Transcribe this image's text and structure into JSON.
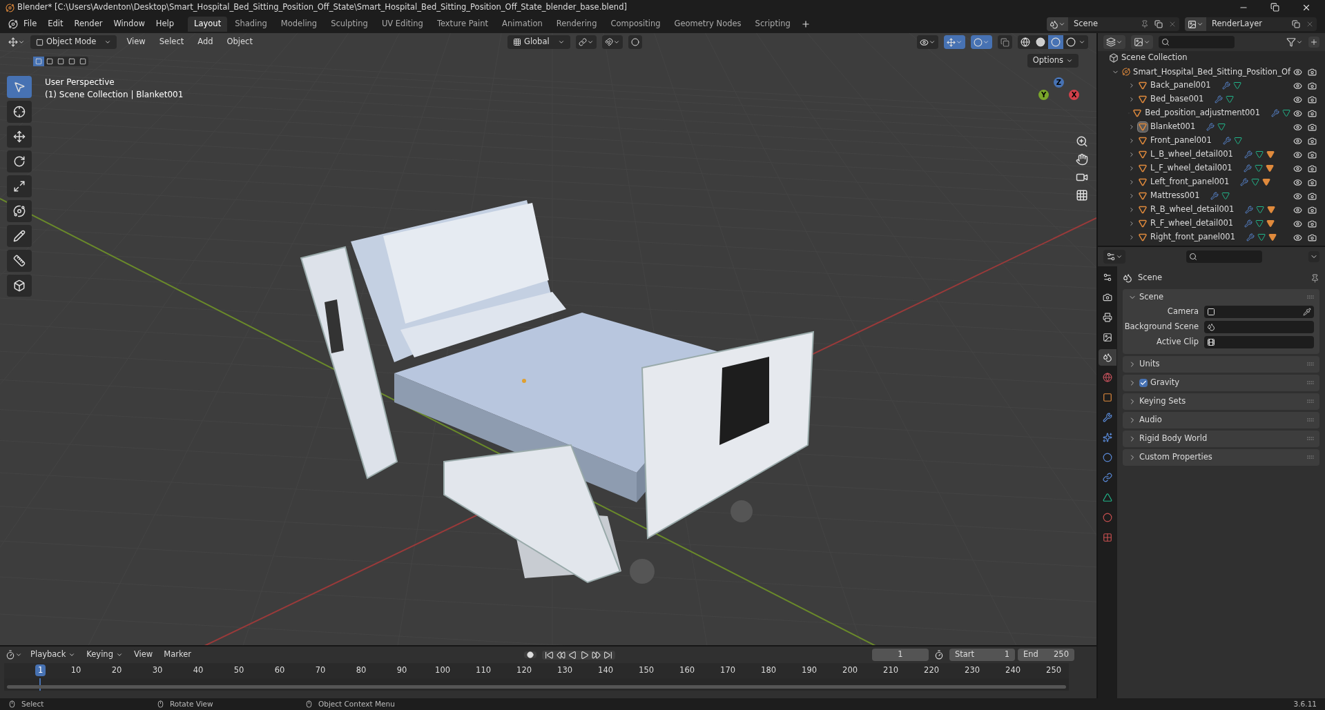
{
  "window": {
    "title": "Blender* [C:\\Users\\Avdenton\\Desktop\\Smart_Hospital_Bed_Sitting_Position_Off_State\\Smart_Hospital_Bed_Sitting_Position_Off_State_blender_base.blend]"
  },
  "menu": [
    "File",
    "Edit",
    "Render",
    "Window",
    "Help"
  ],
  "workspaces": [
    {
      "label": "Layout",
      "selected": true
    },
    {
      "label": "Shading",
      "selected": false
    },
    {
      "label": "Modeling",
      "selected": false
    },
    {
      "label": "Sculpting",
      "selected": false
    },
    {
      "label": "UV Editing",
      "selected": false
    },
    {
      "label": "Texture Paint",
      "selected": false
    },
    {
      "label": "Animation",
      "selected": false
    },
    {
      "label": "Rendering",
      "selected": false
    },
    {
      "label": "Compositing",
      "selected": false
    },
    {
      "label": "Geometry Nodes",
      "selected": false
    },
    {
      "label": "Scripting",
      "selected": false
    }
  ],
  "scene_selector": {
    "scene": "Scene",
    "view_layer": "RenderLayer"
  },
  "header": {
    "mode": "Object Mode",
    "menus": [
      "View",
      "Select",
      "Add",
      "Object"
    ],
    "orientation": "Global",
    "options": "Options"
  },
  "tools": [
    {
      "kind": "select",
      "selected": true
    },
    {
      "kind": "cursor",
      "selected": false
    },
    {
      "kind": "move",
      "selected": false
    },
    {
      "kind": "rotate",
      "selected": false
    },
    {
      "kind": "scale",
      "selected": false
    },
    {
      "kind": "transform",
      "selected": false
    },
    {
      "kind": "annotate",
      "selected": false
    },
    {
      "kind": "measure",
      "selected": false
    },
    {
      "kind": "add",
      "selected": false
    }
  ],
  "viewport": {
    "info": [
      "User Perspective",
      "(1) Scene Collection | Blanket001"
    ],
    "gizmo_axes": [
      "Z",
      "Y",
      "X"
    ]
  },
  "outliner": {
    "root": "Scene Collection",
    "collection": {
      "name": "Smart_Hospital_Bed_Sitting_Position_Of",
      "expanded": true,
      "children": [
        {
          "name": "Back_panel001",
          "selected": false,
          "material": false
        },
        {
          "name": "Bed_base001",
          "selected": false,
          "material": false
        },
        {
          "name": "Bed_position_adjustment001",
          "selected": false,
          "material": false
        },
        {
          "name": "Blanket001",
          "selected": true,
          "material": false
        },
        {
          "name": "Front_panel001",
          "selected": false,
          "material": false
        },
        {
          "name": "L_B_wheel_detail001",
          "selected": false,
          "material": true
        },
        {
          "name": "L_F_wheel_detail001",
          "selected": false,
          "material": true
        },
        {
          "name": "Left_front_panel001",
          "selected": false,
          "material": true
        },
        {
          "name": "Mattress001",
          "selected": false,
          "material": false
        },
        {
          "name": "R_B_wheel_detail001",
          "selected": false,
          "material": true
        },
        {
          "name": "R_F_wheel_detail001",
          "selected": false,
          "material": true
        },
        {
          "name": "Right_front_panel001",
          "selected": false,
          "material": true
        }
      ]
    }
  },
  "property_tabs": [
    {
      "kind": "tool",
      "selected": false
    },
    {
      "kind": "render",
      "selected": false
    },
    {
      "kind": "output",
      "selected": false
    },
    {
      "kind": "view_layer",
      "selected": false
    },
    {
      "kind": "scene",
      "selected": true
    },
    {
      "kind": "world",
      "selected": false
    },
    {
      "kind": "object",
      "selected": false
    },
    {
      "kind": "modifiers",
      "selected": false
    },
    {
      "kind": "particles",
      "selected": false
    },
    {
      "kind": "physics",
      "selected": false
    },
    {
      "kind": "constraints",
      "selected": false
    },
    {
      "kind": "data",
      "selected": false
    },
    {
      "kind": "material",
      "selected": false
    },
    {
      "kind": "texture",
      "selected": false
    }
  ],
  "properties": {
    "title": "Scene",
    "panels": [
      {
        "label": "Scene",
        "expanded": true,
        "fields": [
          {
            "label": "Camera",
            "kind": "camera"
          },
          {
            "label": "Background Scene",
            "kind": "scene"
          },
          {
            "label": "Active Clip",
            "kind": "clip"
          }
        ]
      },
      {
        "label": "Units",
        "expanded": false
      },
      {
        "label": "Gravity",
        "expanded": false,
        "checked": true
      },
      {
        "label": "Keying Sets",
        "expanded": false
      },
      {
        "label": "Audio",
        "expanded": false
      },
      {
        "label": "Rigid Body World",
        "expanded": false
      },
      {
        "label": "Custom Properties",
        "expanded": false
      }
    ]
  },
  "timeline": {
    "menus": [
      "Playback",
      "Keying",
      "View",
      "Marker"
    ],
    "current_frame": "1",
    "start_label": "Start",
    "start": "1",
    "end_label": "End",
    "end": "250",
    "ticks": [
      "1",
      "10",
      "20",
      "30",
      "40",
      "50",
      "60",
      "70",
      "80",
      "90",
      "100",
      "110",
      "120",
      "130",
      "140",
      "150",
      "160",
      "170",
      "180",
      "190",
      "200",
      "210",
      "220",
      "230",
      "240",
      "250"
    ]
  },
  "status_bar": {
    "hints": [
      "Select",
      "Rotate View",
      "Object Context Menu"
    ],
    "version": "3.6.11"
  }
}
